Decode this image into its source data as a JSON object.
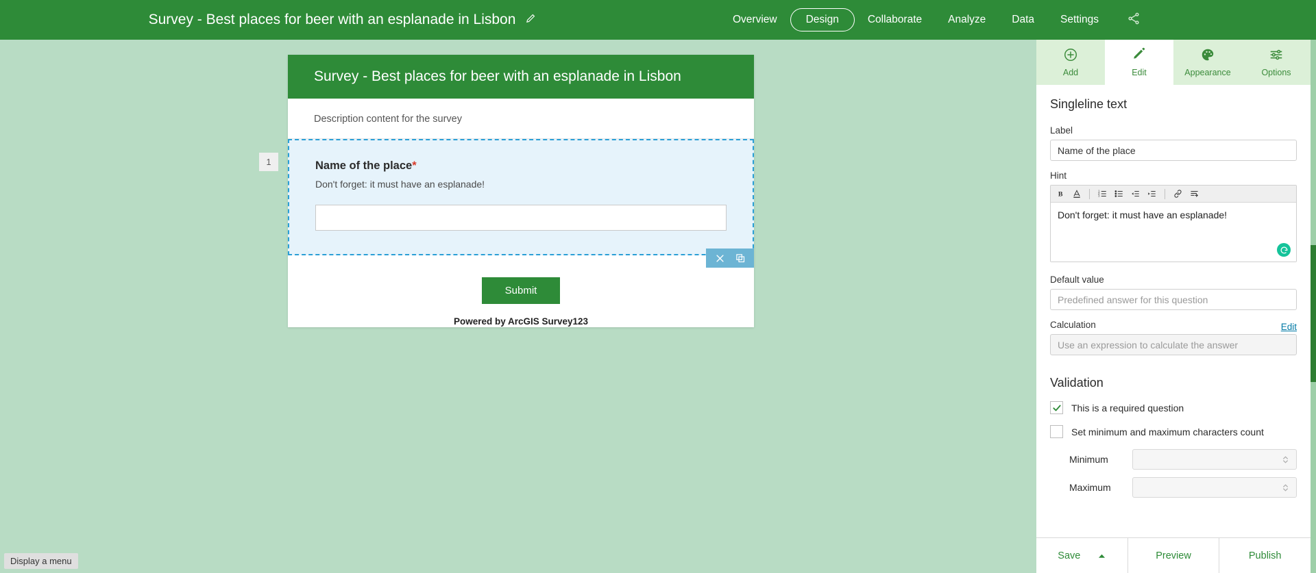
{
  "topbar": {
    "title": "Survey - Best places for beer with an esplanade in Lisbon",
    "edit_title_icon": "pencil-icon",
    "share_icon": "share-icon",
    "nav": [
      {
        "label": "Overview",
        "active": false
      },
      {
        "label": "Design",
        "active": true
      },
      {
        "label": "Collaborate",
        "active": false
      },
      {
        "label": "Analyze",
        "active": false
      },
      {
        "label": "Data",
        "active": false
      },
      {
        "label": "Settings",
        "active": false
      }
    ]
  },
  "canvas": {
    "survey_title": "Survey - Best places for beer with an esplanade in Lisbon",
    "survey_description": "Description content for the survey",
    "question": {
      "number": "1",
      "label": "Name of the place",
      "required_marker": "*",
      "hint": "Don't forget: it must have an esplanade!",
      "value": "",
      "toolbar": {
        "delete_icon": "close-icon",
        "duplicate_icon": "duplicate-icon"
      }
    },
    "submit_label": "Submit",
    "powered_by": "Powered by ArcGIS Survey123"
  },
  "status_tip": "Display a menu",
  "panel": {
    "tabs": [
      {
        "label": "Add",
        "icon": "plus-circle-icon",
        "active": false
      },
      {
        "label": "Edit",
        "icon": "pencil-icon",
        "active": true
      },
      {
        "label": "Appearance",
        "icon": "palette-icon",
        "active": false
      },
      {
        "label": "Options",
        "icon": "sliders-icon",
        "active": false
      }
    ],
    "heading": "Singleline text",
    "label_field": {
      "label": "Label",
      "value": "Name of the place",
      "placeholder": "Name of the place"
    },
    "hint_field": {
      "label": "Hint",
      "value": "Don't forget: it must have an esplanade!",
      "toolbar": [
        {
          "name": "bold-icon",
          "glyph": "B"
        },
        {
          "name": "font-color-icon",
          "glyph": "A"
        },
        {
          "name": "ordered-list-icon",
          "glyph": ""
        },
        {
          "name": "unordered-list-icon",
          "glyph": ""
        },
        {
          "name": "outdent-icon",
          "glyph": ""
        },
        {
          "name": "indent-icon",
          "glyph": ""
        },
        {
          "name": "link-icon",
          "glyph": ""
        },
        {
          "name": "line-break-icon",
          "glyph": ""
        }
      ],
      "assistant_icon": "grammarly-icon"
    },
    "default_value_field": {
      "label": "Default value",
      "value": "",
      "placeholder": "Predefined answer for this question"
    },
    "calculation_field": {
      "label": "Calculation",
      "edit_link": "Edit",
      "value": "",
      "placeholder": "Use an expression to calculate the answer"
    },
    "validation": {
      "heading": "Validation",
      "required_checkbox": {
        "label": "This is a required question",
        "checked": true
      },
      "minmax_checkbox": {
        "label": "Set minimum and maximum characters count",
        "checked": false
      },
      "minimum": {
        "label": "Minimum",
        "value": "",
        "disabled": true
      },
      "maximum": {
        "label": "Maximum",
        "value": "",
        "disabled": true
      }
    },
    "footer": {
      "save_label": "Save",
      "save_caret_icon": "caret-up-icon",
      "preview_label": "Preview",
      "publish_label": "Publish"
    }
  },
  "colors": {
    "brand_green": "#2e8b38",
    "canvas_green": "#b8dcc4",
    "panel_tab_green": "#dcf0d8",
    "selection_blue": "#2a9fd6",
    "selection_fill": "#e6f3fb",
    "toolbar_blue": "#6cb4d4",
    "required_red": "#d83b2a",
    "link_teal": "#0079a5",
    "assistant_green": "#15c39a"
  }
}
